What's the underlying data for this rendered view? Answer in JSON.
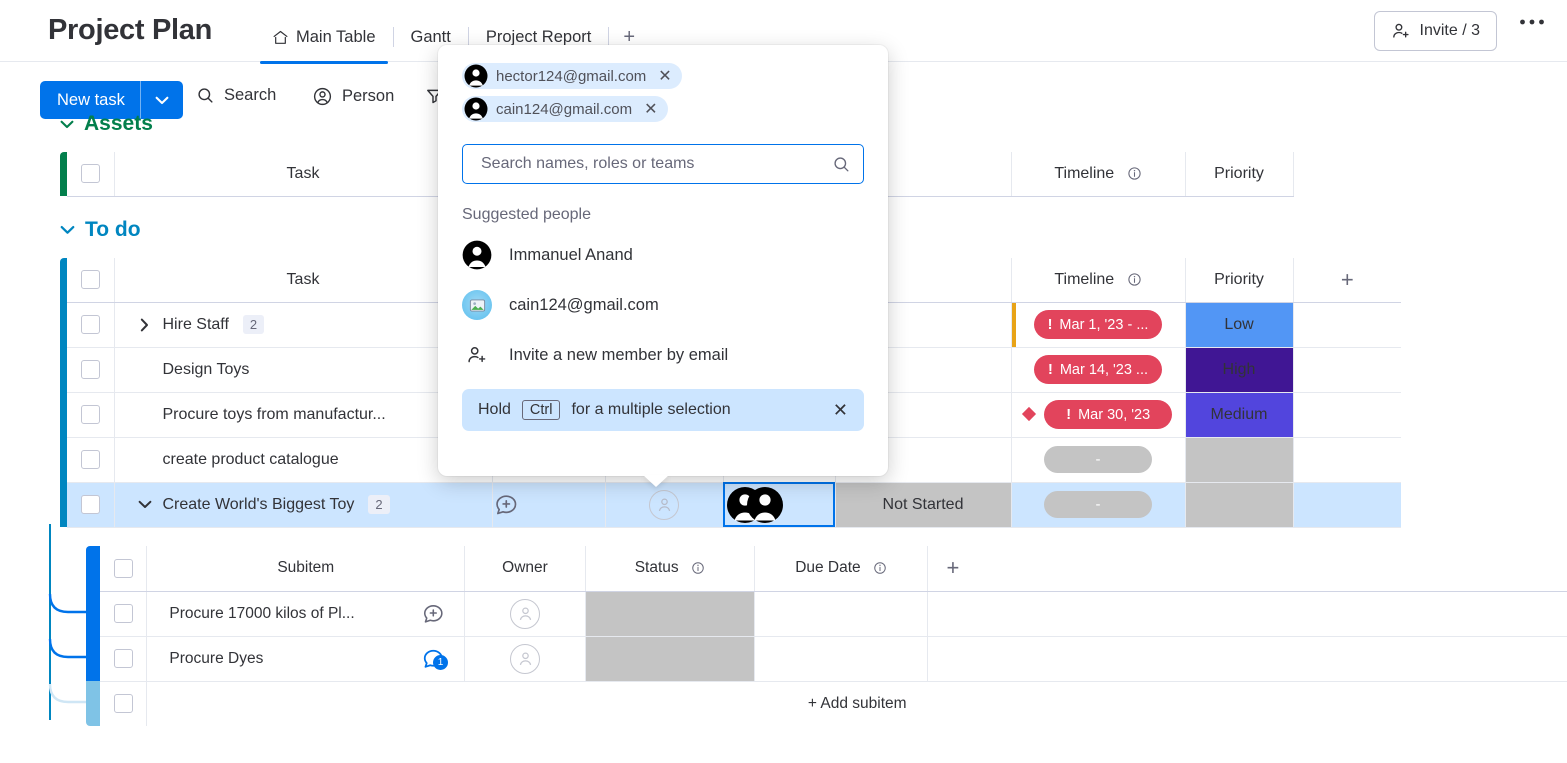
{
  "header": {
    "board_title": "Project Plan",
    "tabs": [
      {
        "label": "Main Table",
        "icon": "home-icon",
        "active": true
      },
      {
        "label": "Gantt",
        "icon": "",
        "active": false
      },
      {
        "label": "Project Report",
        "icon": "",
        "active": false
      }
    ],
    "add_tab_label": "+",
    "invite_label": "Invite / 3",
    "invite_icon": "person-add-icon",
    "more_icon": "ellipsis-icon"
  },
  "toolbar": {
    "new_task_label": "New task",
    "new_task_caret_icon": "chevron-down-icon",
    "search_label": "Search",
    "search_icon": "search-icon",
    "person_label": "Person",
    "person_icon": "person-circle-icon",
    "filter_icon": "filter-icon"
  },
  "groups": [
    {
      "name": "Assets",
      "color": "#037f4c",
      "collapse_icon": "chevron-down-icon",
      "columns": [
        "Task",
        "Timeline",
        "Priority"
      ],
      "rows": []
    },
    {
      "name": "To do",
      "color": "#0086c0",
      "collapse_icon": "chevron-down-icon",
      "columns": [
        {
          "label": "Task",
          "info": false
        },
        {
          "label": "Timeline",
          "info": true
        },
        {
          "label": "Priority",
          "info": false
        },
        {
          "label": "+",
          "info": false
        }
      ],
      "rows": [
        {
          "task": "Hire Staff",
          "subitem_count": "2",
          "expanded": false,
          "has_chevron": true,
          "update_icon": "comment-add-icon",
          "owner": "",
          "person": "",
          "status": "",
          "timeline": "Mar 1, '23 - ...",
          "timeline_overdue": true,
          "timeline_marker": false,
          "priority": "Low",
          "priority_color": "#5296f5",
          "left_accent": "#e8a317"
        },
        {
          "task": "Design Toys",
          "subitem_count": "",
          "expanded": false,
          "has_chevron": false,
          "update_icon": "comment-add-icon",
          "owner": "",
          "person": "",
          "status": "",
          "timeline": "Mar 14, '23 ...",
          "timeline_overdue": true,
          "timeline_marker": false,
          "priority": "High",
          "priority_color": "#401694",
          "left_accent": ""
        },
        {
          "task": "Procure toys from manufactur...",
          "subitem_count": "",
          "expanded": false,
          "has_chevron": false,
          "update_icon": "comment-add-icon",
          "owner": "",
          "person": "",
          "status": "",
          "timeline": "Mar 30, '23",
          "timeline_overdue": true,
          "timeline_marker": true,
          "priority": "Medium",
          "priority_color": "#5245dd",
          "left_accent": ""
        },
        {
          "task": "create product catalogue",
          "subitem_count": "",
          "expanded": false,
          "has_chevron": false,
          "update_icon": "comment-add-icon",
          "owner": "",
          "person": "",
          "status": "",
          "timeline": "-",
          "timeline_overdue": false,
          "timeline_marker": false,
          "priority": "",
          "priority_color": "#c4c4c4",
          "left_accent": ""
        },
        {
          "task": "Create World's Biggest Toy",
          "subitem_count": "2",
          "expanded": true,
          "has_chevron": true,
          "update_icon": "comment-add-icon",
          "owner": "",
          "person": "two-people-avatars",
          "status": "Not Started",
          "status_color": "#c4c4c4",
          "timeline": "-",
          "timeline_overdue": false,
          "timeline_marker": false,
          "priority": "",
          "priority_color": "#c4c4c4",
          "left_accent": "",
          "selected": true,
          "person_cell_selected": true
        }
      ]
    }
  ],
  "subitems": {
    "columns": [
      {
        "label": "Subitem",
        "info": false
      },
      {
        "label": "Owner",
        "info": false
      },
      {
        "label": "Status",
        "info": true
      },
      {
        "label": "Due Date",
        "info": true
      },
      {
        "label": "+",
        "info": false
      }
    ],
    "rows": [
      {
        "name": "Procure 17000 kilos of Pl...",
        "update_icon": "comment-add-icon",
        "update_count": "",
        "owner": "",
        "status": "",
        "status_color": "#c4c4c4",
        "due_date": ""
      },
      {
        "name": "Procure Dyes",
        "update_icon": "comment-icon",
        "update_count": "1",
        "owner": "",
        "status": "",
        "status_color": "#c4c4c4",
        "due_date": ""
      }
    ],
    "add_label": "+ Add subitem"
  },
  "people_popup": {
    "chips": [
      {
        "email": "hector124@gmail.com",
        "avatar": "person-filled-icon",
        "remove_icon": "close-icon"
      },
      {
        "email": "cain124@gmail.com",
        "avatar": "person-filled-icon",
        "remove_icon": "close-icon"
      }
    ],
    "search_placeholder": "Search names, roles or teams",
    "search_value": "",
    "search_icon": "search-icon",
    "suggested_title": "Suggested people",
    "suggested": [
      {
        "label": "Immanuel Anand",
        "avatar": "person-filled-icon"
      },
      {
        "label": "cain124@gmail.com",
        "avatar": "photo-avatar-icon"
      },
      {
        "label": "Invite a new member by email",
        "avatar": "person-add-icon"
      }
    ],
    "hint": {
      "prefix": "Hold",
      "key": "Ctrl",
      "suffix": "for a multiple selection",
      "close_icon": "close-icon"
    }
  },
  "colors": {
    "accent": "#0073ea",
    "group_assets": "#037f4c",
    "group_todo": "#0086c0",
    "overdue": "#e2445c",
    "empty_gray": "#c4c4c4",
    "row_selected": "#cce5ff"
  }
}
